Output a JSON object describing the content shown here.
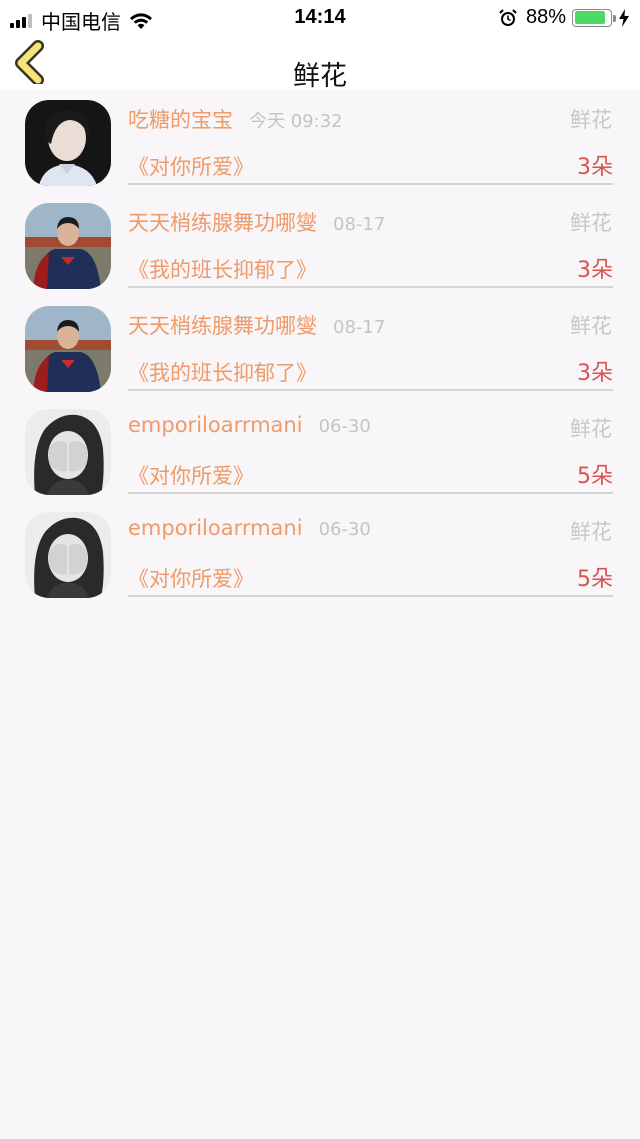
{
  "status_bar": {
    "carrier": "中国电信",
    "time": "14:14",
    "battery_percent": "88%",
    "battery_level": 0.88,
    "icons": [
      "signal-icon",
      "wifi-icon",
      "alarm-icon",
      "battery-icon",
      "charging-icon"
    ]
  },
  "nav": {
    "title": "鲜花",
    "back_icon": "chevron-left-icon"
  },
  "items": [
    {
      "user": "吃糖的宝宝",
      "date": "今天 09:32",
      "type": "鲜花",
      "song": "《对你所爱》",
      "count": "3朵",
      "avatar": "portrait-photo"
    },
    {
      "user": "天天梢练腺舞功哪燮",
      "date": "08-17",
      "type": "鲜花",
      "song": "《我的班长抑郁了》",
      "count": "3朵",
      "avatar": "superhero-photo"
    },
    {
      "user": "天天梢练腺舞功哪燮",
      "date": "08-17",
      "type": "鲜花",
      "song": "《我的班长抑郁了》",
      "count": "3朵",
      "avatar": "superhero-photo"
    },
    {
      "user": "emporiloarrmani",
      "date": "06-30",
      "type": "鲜花",
      "song": "《对你所爱》",
      "count": "5朵",
      "avatar": "covered-face-photo"
    },
    {
      "user": "emporiloarrmani",
      "date": "06-30",
      "type": "鲜花",
      "song": "《对你所爱》",
      "count": "5朵",
      "avatar": "covered-face-photo"
    }
  ],
  "colors": {
    "accent": "#ef9a68",
    "count": "#d9534f",
    "muted": "#c4c4c4",
    "background": "#f8f6f8"
  }
}
